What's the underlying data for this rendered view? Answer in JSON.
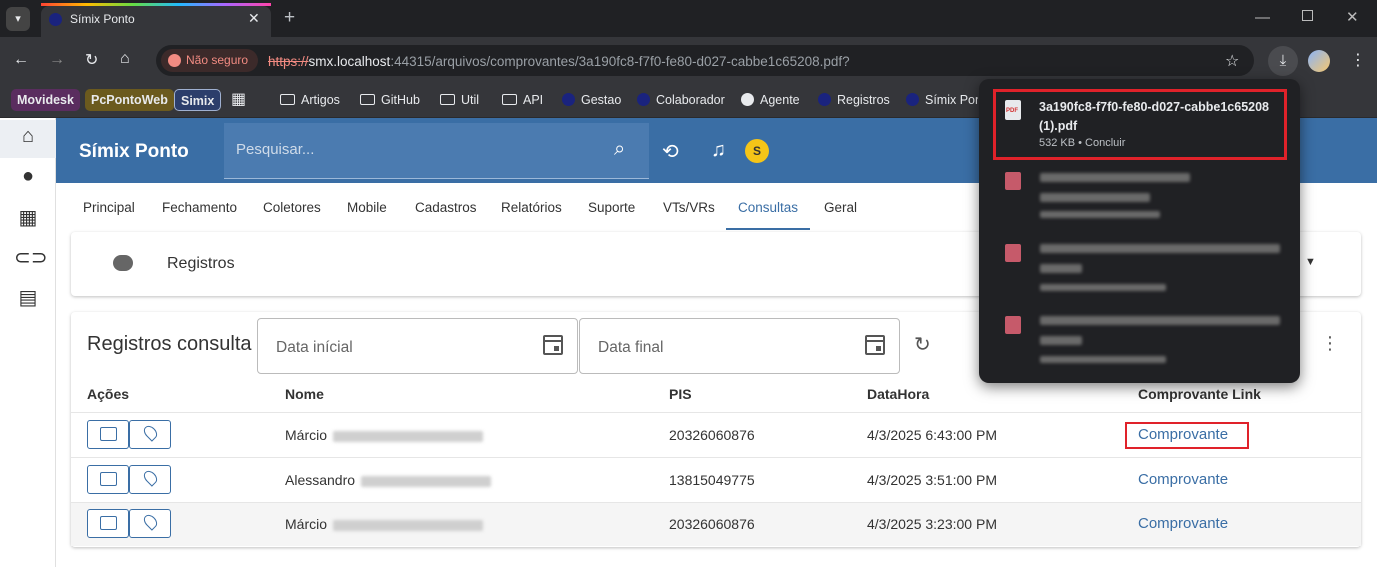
{
  "browser": {
    "tab_title": "Símix Ponto",
    "tab_close": "✕",
    "new_tab": "+",
    "insecure_label": "Não seguro",
    "url_scheme": "https://",
    "url_host": "smx.localhost",
    "url_rest": ":44315/arquivos/comprovantes/3a190fc8-f7f0-fe80-d027-cabbe1c65208.pdf?",
    "bookmarks": [
      "Movidesk",
      "PcPontoWeb",
      "Simix",
      "Artigos",
      "GitHub",
      "Util",
      "API",
      "Gestao",
      "Colaborador",
      "Agente",
      "Registros",
      "Símix Pon"
    ]
  },
  "app": {
    "brand": "Símix Ponto",
    "search_placeholder": "Pesquisar...",
    "avatar_letter": "S",
    "nav_tabs": [
      "Principal",
      "Fechamento",
      "Coletores",
      "Mobile",
      "Cadastros",
      "Relatórios",
      "Suporte",
      "VTs/VRs",
      "Consultas",
      "Geral"
    ],
    "active_tab": "Consultas",
    "section_title": "Registros",
    "card_title": "Registros consulta",
    "date_start_placeholder": "Data inícial",
    "date_end_placeholder": "Data final",
    "columns": [
      "Ações",
      "Nome",
      "PIS",
      "DataHora",
      "Comprovante Link"
    ],
    "rows": [
      {
        "name": "Márcio",
        "pis": "20326060876",
        "datetime": "4/3/2025 6:43:00 PM",
        "link": "Comprovante"
      },
      {
        "name": "Alessandro",
        "pis": "13815049775",
        "datetime": "4/3/2025 3:51:00 PM",
        "link": "Comprovante"
      },
      {
        "name": "Márcio",
        "pis": "20326060876",
        "datetime": "4/3/2025 3:23:00 PM",
        "link": "Comprovante"
      }
    ]
  },
  "downloads": {
    "items": [
      {
        "file_name": "3a190fc8-f7f0-fe80-d027-cabbe1c65208 (1).pdf",
        "status": "532 KB • Concluir",
        "icon_label": "PDF"
      }
    ]
  },
  "colors": {
    "accent": "#3a6ea5",
    "highlight": "#e0222a",
    "chrome_dark": "#202124"
  }
}
